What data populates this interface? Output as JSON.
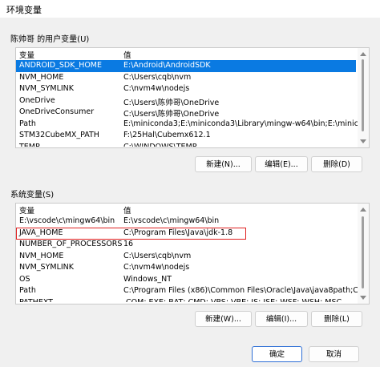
{
  "window": {
    "title": "环境变量"
  },
  "user_vars": {
    "label": "陈帅哥 的用户变量(U)",
    "col_variable": "变量",
    "col_value": "值",
    "rows": [
      {
        "name": "ANDROID_SDK_HOME",
        "value": "E:\\Android\\AndroidSDK",
        "selected": true
      },
      {
        "name": "NVM_HOME",
        "value": "C:\\Users\\cqb\\nvm"
      },
      {
        "name": "NVM_SYMLINK",
        "value": "C:\\nvm4w\\nodejs"
      },
      {
        "name": "OneDrive",
        "value": "C:\\Users\\陈帅哥\\OneDrive"
      },
      {
        "name": "OneDriveConsumer",
        "value": "C:\\Users\\陈帅哥\\OneDrive"
      },
      {
        "name": "Path",
        "value": "E:\\miniconda3;E:\\miniconda3\\Library\\mingw-w64\\bin;E:\\minico..."
      },
      {
        "name": "STM32CubeMX_PATH",
        "value": "F:\\25Hal\\Cubemx612.1"
      },
      {
        "name": "TEMP",
        "value": "C:\\WINDOWS\\TEMP"
      }
    ],
    "buttons": {
      "new": "新建(N)...",
      "edit": "编辑(E)...",
      "delete": "删除(D)"
    }
  },
  "system_vars": {
    "label": "系统变量(S)",
    "col_variable": "变量",
    "col_value": "值",
    "rows": [
      {
        "name": "E:\\vscode\\c\\mingw64\\bin",
        "value": "E:\\vscode\\c\\mingw64\\bin"
      },
      {
        "name": "JAVA_HOME",
        "value": "C:\\Program Files\\Java\\jdk-1.8",
        "highlighted": true
      },
      {
        "name": "NUMBER_OF_PROCESSORS",
        "value": "16"
      },
      {
        "name": "NVM_HOME",
        "value": "C:\\Users\\cqb\\nvm"
      },
      {
        "name": "NVM_SYMLINK",
        "value": "C:\\nvm4w\\nodejs"
      },
      {
        "name": "OS",
        "value": "Windows_NT"
      },
      {
        "name": "Path",
        "value": "C:\\Program Files (x86)\\Common Files\\Oracle\\Java\\java8path;C:\\Pro..."
      },
      {
        "name": "PATHEXT",
        "value": ".COM;.EXE;.BAT;.CMD;.VBS;.VBE;.JS;.JSE;.WSF;.WSH;.MSC"
      }
    ],
    "buttons": {
      "new": "新建(W)...",
      "edit": "编辑(I)...",
      "delete": "删除(L)"
    }
  },
  "dialog_buttons": {
    "ok": "确定",
    "cancel": "取消"
  },
  "colors": {
    "selection": "#0a7ae2",
    "highlight_box": "#e02020"
  }
}
